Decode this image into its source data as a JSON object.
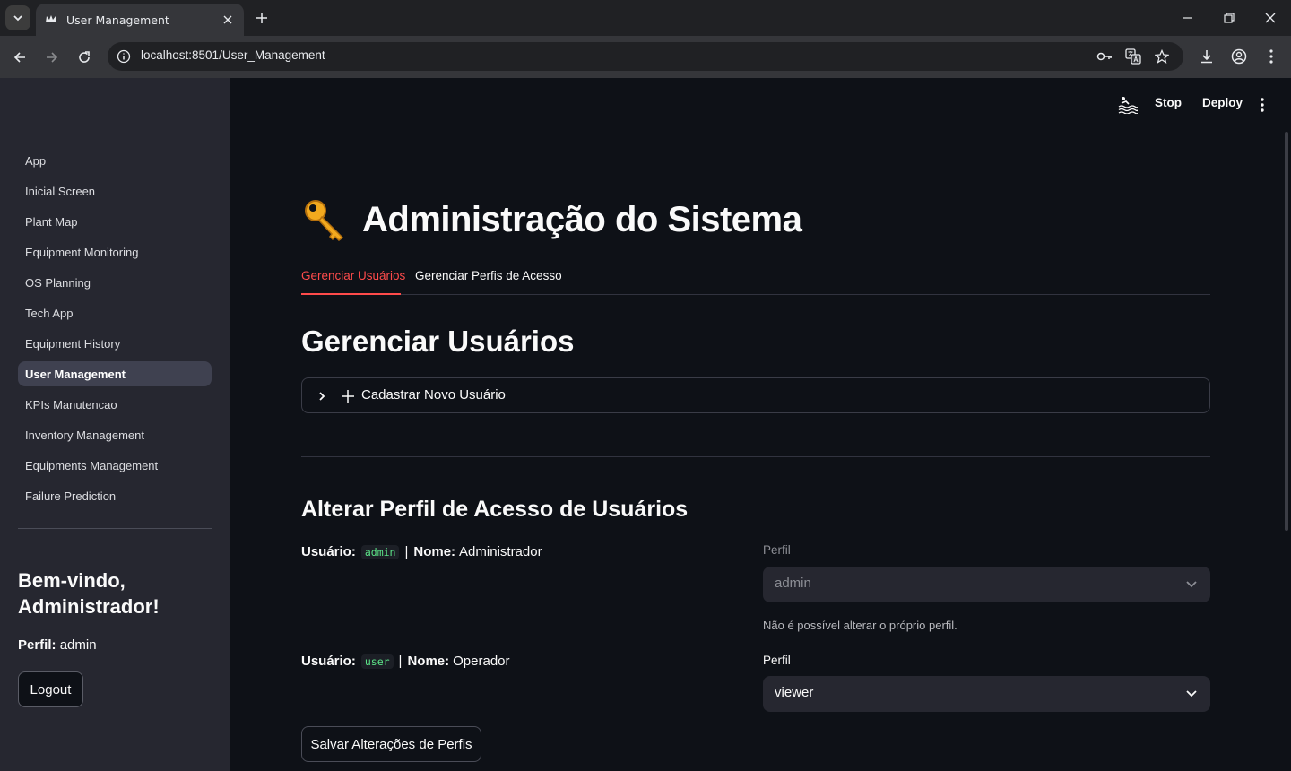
{
  "browser": {
    "tab_title": "User Management",
    "url": "localhost:8501/User_Management"
  },
  "header": {
    "stop_label": "Stop",
    "deploy_label": "Deploy"
  },
  "sidebar": {
    "items": [
      {
        "label": "App"
      },
      {
        "label": "Inicial Screen"
      },
      {
        "label": "Plant Map"
      },
      {
        "label": "Equipment Monitoring"
      },
      {
        "label": "OS Planning"
      },
      {
        "label": "Tech App"
      },
      {
        "label": "Equipment History"
      },
      {
        "label": "User Management"
      },
      {
        "label": "KPIs Manutencao"
      },
      {
        "label": "Inventory Management"
      },
      {
        "label": "Equipments Management"
      },
      {
        "label": "Failure Prediction"
      }
    ],
    "active_index": 7,
    "welcome": "Bem-vindo, Administrador!",
    "perfil_label": "Perfil:",
    "perfil_value": "admin",
    "logout_label": "Logout"
  },
  "main": {
    "title": "Administração do Sistema",
    "tabs": [
      {
        "label": "Gerenciar Usuários"
      },
      {
        "label": "Gerenciar Perfis de Acesso"
      }
    ],
    "section_title": "Gerenciar Usuários",
    "expander_label": "Cadastrar Novo Usuário",
    "subsection_title": "Alterar Perfil de Acesso de Usuários",
    "users": [
      {
        "usuario_label": "Usuário:",
        "username": "admin",
        "sep": "|",
        "nome_label": "Nome:",
        "name": "Administrador",
        "field_label": "Perfil",
        "perfil": "admin",
        "disabled": true,
        "help": "Não é possível alterar o próprio perfil."
      },
      {
        "usuario_label": "Usuário:",
        "username": "user",
        "sep": "|",
        "nome_label": "Nome:",
        "name": "Operador",
        "field_label": "Perfil",
        "perfil": "viewer",
        "disabled": false
      }
    ],
    "save_label": "Salvar Alterações de Perfis"
  },
  "colors": {
    "accent": "#ff4b4b",
    "sidebar_bg": "#262730",
    "main_bg": "#0e1117",
    "code_green": "#5ce488"
  }
}
